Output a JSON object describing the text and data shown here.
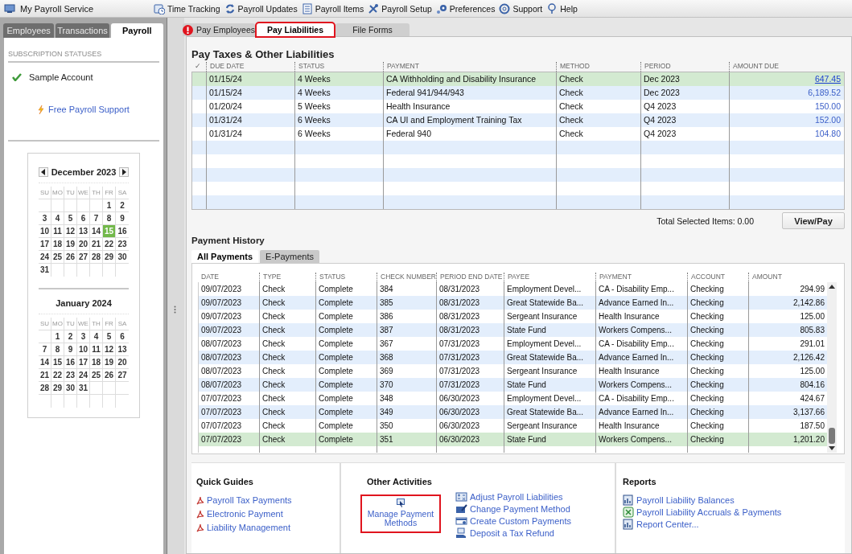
{
  "menu_bar": {
    "title": "My Payroll Service",
    "items": [
      {
        "label": "Time Tracking"
      },
      {
        "label": "Payroll Updates"
      },
      {
        "label": "Payroll Items"
      },
      {
        "label": "Payroll Setup"
      },
      {
        "label": "Preferences"
      },
      {
        "label": "Support"
      },
      {
        "label": "Help"
      }
    ]
  },
  "left_tabs": [
    {
      "label": "Employees",
      "selected": false
    },
    {
      "label": "Transactions",
      "selected": false
    },
    {
      "label": "Payroll",
      "selected": true
    }
  ],
  "subscription": {
    "heading": "SUBSCRIPTION STATUSES",
    "status": "Sample Account",
    "support_link": "Free Payroll Support"
  },
  "calendars": [
    {
      "title": "December 2023",
      "weekdays": [
        "SU",
        "MO",
        "TU",
        "WE",
        "TH",
        "FR",
        "SA"
      ],
      "weeks": [
        [
          {
            "day": "1",
            "selected": false
          },
          {
            "day": "2",
            "selected": false
          }
        ],
        [
          {
            "day": "3",
            "selected": false
          },
          {
            "day": "4",
            "selected": false
          },
          {
            "day": "5",
            "selected": false
          },
          {
            "day": "6",
            "selected": false
          },
          {
            "day": "7",
            "selected": false
          },
          {
            "day": "8",
            "selected": false
          },
          {
            "day": "9",
            "selected": false
          }
        ],
        [
          {
            "day": "10",
            "selected": false
          },
          {
            "day": "11",
            "selected": false
          },
          {
            "day": "12",
            "selected": false
          },
          {
            "day": "13",
            "selected": false
          },
          {
            "day": "14",
            "selected": false
          },
          {
            "day": "15",
            "selected": true
          },
          {
            "day": "16",
            "selected": false
          }
        ],
        [
          {
            "day": "17",
            "selected": false
          },
          {
            "day": "18",
            "selected": false
          },
          {
            "day": "19",
            "selected": false
          },
          {
            "day": "20",
            "selected": false
          },
          {
            "day": "21",
            "selected": false
          },
          {
            "day": "22",
            "selected": false
          },
          {
            "day": "23",
            "selected": false
          }
        ],
        [
          {
            "day": "24",
            "selected": false
          },
          {
            "day": "25",
            "selected": false
          },
          {
            "day": "26",
            "selected": false
          },
          {
            "day": "27",
            "selected": false
          },
          {
            "day": "28",
            "selected": false
          },
          {
            "day": "29",
            "selected": false
          },
          {
            "day": "30",
            "selected": false
          }
        ],
        [
          {
            "day": "31",
            "selected": false
          }
        ]
      ]
    },
    {
      "title": "January 2024",
      "weekdays": [
        "SU",
        "MO",
        "TU",
        "WE",
        "TH",
        "FR",
        "SA"
      ],
      "weeks": [
        [
          {
            "day": "1",
            "selected": false
          },
          {
            "day": "2",
            "selected": false
          },
          {
            "day": "3",
            "selected": false
          },
          {
            "day": "4",
            "selected": false
          },
          {
            "day": "5",
            "selected": false
          },
          {
            "day": "6",
            "selected": false
          }
        ],
        [
          {
            "day": "7",
            "selected": false
          },
          {
            "day": "8",
            "selected": false
          },
          {
            "day": "9",
            "selected": false
          },
          {
            "day": "10",
            "selected": false
          },
          {
            "day": "11",
            "selected": false
          },
          {
            "day": "12",
            "selected": false
          },
          {
            "day": "13",
            "selected": false
          }
        ],
        [
          {
            "day": "14",
            "selected": false
          },
          {
            "day": "15",
            "selected": false
          },
          {
            "day": "16",
            "selected": false
          },
          {
            "day": "17",
            "selected": false
          },
          {
            "day": "18",
            "selected": false
          },
          {
            "day": "19",
            "selected": false
          },
          {
            "day": "20",
            "selected": false
          }
        ],
        [
          {
            "day": "21",
            "selected": false
          },
          {
            "day": "22",
            "selected": false
          },
          {
            "day": "23",
            "selected": false
          },
          {
            "day": "24",
            "selected": false
          },
          {
            "day": "25",
            "selected": false
          },
          {
            "day": "26",
            "selected": false
          },
          {
            "day": "27",
            "selected": false
          }
        ],
        [
          {
            "day": "28",
            "selected": false
          },
          {
            "day": "29",
            "selected": false
          },
          {
            "day": "30",
            "selected": false
          },
          {
            "day": "31",
            "selected": false
          }
        ]
      ]
    }
  ],
  "main_tabs": [
    {
      "label": "Pay Employees",
      "selected": false,
      "alert": true,
      "highlighted": false
    },
    {
      "label": "Pay Liabilities",
      "selected": true,
      "alert": false,
      "highlighted": true
    },
    {
      "label": "File Forms",
      "selected": false,
      "alert": false,
      "highlighted": false
    }
  ],
  "liabilities": {
    "title": "Pay Taxes & Other Liabilities",
    "columns": [
      "✓",
      "DUE DATE",
      "STATUS",
      "PAYMENT",
      "METHOD",
      "PERIOD",
      "AMOUNT DUE"
    ],
    "rows": [
      {
        "cells": [
          "",
          "01/15/24",
          "4 Weeks",
          "CA Withholding and Disability Insurance",
          "Check",
          "Dec 2023",
          "647.45"
        ],
        "selected": true
      },
      {
        "cells": [
          "",
          "01/15/24",
          "4 Weeks",
          "Federal 941/944/943",
          "Check",
          "Dec 2023",
          "6,189.52"
        ],
        "selected": false
      },
      {
        "cells": [
          "",
          "01/20/24",
          "5 Weeks",
          "Health Insurance",
          "Check",
          "Q4 2023",
          "150.00"
        ],
        "selected": false
      },
      {
        "cells": [
          "",
          "01/31/24",
          "6 Weeks",
          "CA UI and Employment Training Tax",
          "Check",
          "Q4 2023",
          "152.00"
        ],
        "selected": false
      },
      {
        "cells": [
          "",
          "01/31/24",
          "6 Weeks",
          "Federal 940",
          "Check",
          "Q4 2023",
          "104.80"
        ],
        "selected": false
      }
    ],
    "total": "Total Selected Items: 0.00",
    "button": "View/Pay"
  },
  "payment_history": {
    "title": "Payment History",
    "tabs": [
      {
        "label": "All Payments",
        "selected": true
      },
      {
        "label": "E-Payments",
        "selected": false
      }
    ],
    "columns": [
      "DATE",
      "TYPE",
      "STATUS",
      "CHECK NUMBER",
      "PERIOD END DATE",
      "PAYEE",
      "PAYMENT",
      "ACCOUNT",
      "AMOUNT"
    ],
    "rows": [
      {
        "cells": [
          "09/07/2023",
          "Check",
          "Complete",
          "384",
          "08/31/2023",
          "Employment Devel...",
          "CA - Disability Emp...",
          "Checking",
          "294.99"
        ],
        "selected": false
      },
      {
        "cells": [
          "09/07/2023",
          "Check",
          "Complete",
          "385",
          "08/31/2023",
          "Great Statewide Ba...",
          "Advance Earned In...",
          "Checking",
          "2,142.86"
        ],
        "selected": false
      },
      {
        "cells": [
          "09/07/2023",
          "Check",
          "Complete",
          "386",
          "08/31/2023",
          "Sergeant Insurance",
          "Health Insurance",
          "Checking",
          "125.00"
        ],
        "selected": false
      },
      {
        "cells": [
          "09/07/2023",
          "Check",
          "Complete",
          "387",
          "08/31/2023",
          "State Fund",
          "Workers Compens...",
          "Checking",
          "805.83"
        ],
        "selected": false
      },
      {
        "cells": [
          "08/07/2023",
          "Check",
          "Complete",
          "367",
          "07/31/2023",
          "Employment Devel...",
          "CA - Disability Emp...",
          "Checking",
          "291.01"
        ],
        "selected": false
      },
      {
        "cells": [
          "08/07/2023",
          "Check",
          "Complete",
          "368",
          "07/31/2023",
          "Great Statewide Ba...",
          "Advance Earned In...",
          "Checking",
          "2,126.42"
        ],
        "selected": false
      },
      {
        "cells": [
          "08/07/2023",
          "Check",
          "Complete",
          "369",
          "07/31/2023",
          "Sergeant Insurance",
          "Health Insurance",
          "Checking",
          "125.00"
        ],
        "selected": false
      },
      {
        "cells": [
          "08/07/2023",
          "Check",
          "Complete",
          "370",
          "07/31/2023",
          "State Fund",
          "Workers Compens...",
          "Checking",
          "804.16"
        ],
        "selected": false
      },
      {
        "cells": [
          "07/07/2023",
          "Check",
          "Complete",
          "348",
          "06/30/2023",
          "Employment Devel...",
          "CA - Disability Emp...",
          "Checking",
          "424.67"
        ],
        "selected": false
      },
      {
        "cells": [
          "07/07/2023",
          "Check",
          "Complete",
          "349",
          "06/30/2023",
          "Great Statewide Ba...",
          "Advance Earned In...",
          "Checking",
          "3,137.66"
        ],
        "selected": false
      },
      {
        "cells": [
          "07/07/2023",
          "Check",
          "Complete",
          "350",
          "06/30/2023",
          "Sergeant Insurance",
          "Health Insurance",
          "Checking",
          "187.50"
        ],
        "selected": false
      },
      {
        "cells": [
          "07/07/2023",
          "Check",
          "Complete",
          "351",
          "06/30/2023",
          "State Fund",
          "Workers Compens...",
          "Checking",
          "1,201.20"
        ],
        "selected": true
      }
    ]
  },
  "quick_guides": {
    "title": "Quick Guides",
    "links": [
      "Payroll Tax Payments",
      "Electronic Payment",
      "Liability Management"
    ]
  },
  "other_activities": {
    "title": "Other Activities",
    "featured": {
      "label": "Manage Payment Methods",
      "highlighted": true
    },
    "links": [
      {
        "label": "Adjust Payroll Liabilities",
        "kind": "adjust"
      },
      {
        "label": "Change Payment Method",
        "kind": "change"
      },
      {
        "label": "Create Custom Payments",
        "kind": "custom"
      },
      {
        "label": "Deposit a Tax Refund",
        "kind": "refund"
      }
    ]
  },
  "reports": {
    "title": "Reports",
    "links": [
      {
        "label": "Payroll Liability Balances",
        "kind": "report"
      },
      {
        "label": "Payroll Liability Accruals & Payments",
        "kind": "spreadsheet"
      },
      {
        "label": "Report Center...",
        "kind": "report"
      }
    ]
  }
}
